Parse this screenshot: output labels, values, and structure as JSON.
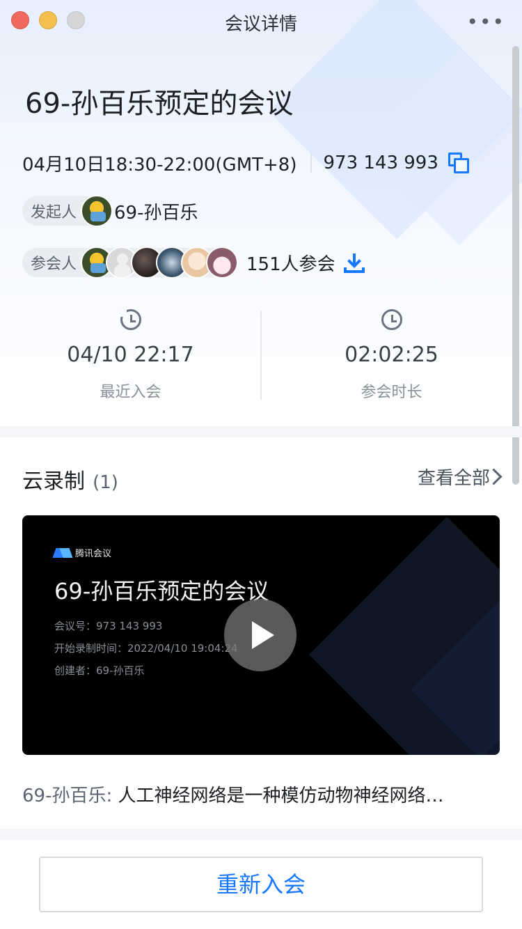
{
  "window": {
    "title": "会议详情",
    "more_label": "•••"
  },
  "meeting": {
    "title": "69-孙百乐预定的会议",
    "time": "04月10日18:30-22:00(GMT+8)",
    "number": "973 143 993"
  },
  "host": {
    "label": "发起人",
    "name": "69-孙百乐"
  },
  "attendees": {
    "label": "参会人",
    "count_text": "151人参会"
  },
  "stats": {
    "recent_join": {
      "value": "04/10 22:17",
      "label": "最近入会"
    },
    "duration": {
      "value": "02:02:25",
      "label": "参会时长"
    }
  },
  "recording": {
    "section_title": "云录制",
    "count": "(1)",
    "view_all": "查看全部",
    "video": {
      "brand": "腾讯会议",
      "title": "69-孙百乐预定的会议",
      "line1": "会议号：973 143 993",
      "line2": "开始录制时间：2022/04/10 19:04:24",
      "line3": "创建者：69-孙百乐"
    },
    "summary_author": "69-孙百乐:",
    "summary_text": "人工神经网络是一种模仿动物神经网络…"
  },
  "footer": {
    "rejoin_label": "重新入会"
  },
  "colors": {
    "accent": "#1677ff"
  }
}
